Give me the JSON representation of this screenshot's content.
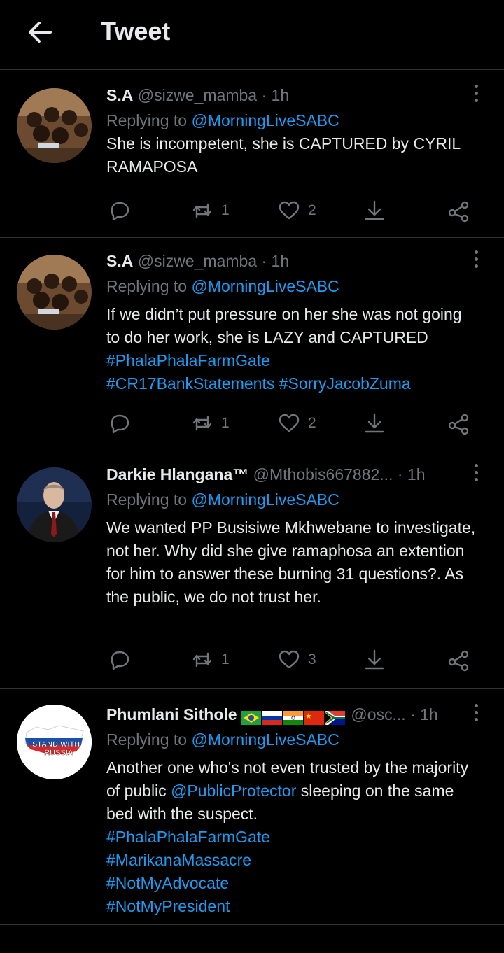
{
  "header": {
    "title": "Tweet",
    "back_icon": "arrow-left-icon"
  },
  "colors": {
    "background": "#000000",
    "text": "#e7e9ea",
    "muted": "#71767b",
    "link": "#1d9bf0",
    "divider": "#2f3336"
  },
  "tweets": [
    {
      "name": "S.A",
      "handle": "@sizwe_mamba",
      "dot": "·",
      "time": "1h",
      "replying_prefix": "Replying to ",
      "replying_to": "@MorningLiveSABC",
      "text_parts": [
        "She is incompetent, she is CAPTURED by CYRIL RAMAPOSA"
      ],
      "retweets": "1",
      "likes": "2"
    },
    {
      "name": "S.A",
      "handle": "@sizwe_mamba",
      "dot": "·",
      "time": "1h",
      "replying_prefix": "Replying to ",
      "replying_to": "@MorningLiveSABC",
      "text_parts": [
        "If we didn’t put pressure on her she was not going to do her work, she is LAZY and CAPTURED ",
        "#PhalaPhalaFarmGate",
        "#CR17BankStatements",
        "#SorryJacobZuma"
      ],
      "retweets": "1",
      "likes": "2"
    },
    {
      "name": "Darkie Hlangana™",
      "handle": "@Mthobis667882...",
      "dot": "·",
      "time": "1h",
      "replying_prefix": "Replying to ",
      "replying_to": "@MorningLiveSABC",
      "text_parts": [
        "We wanted PP Busisiwe Mkhwebane to investigate, not her. Why did she give ramaphosa an extention for him to answer these burning 31 questions?. As the public, we do not trust her."
      ],
      "retweets": "1",
      "likes": "3"
    },
    {
      "name": "Phumlani Sithole",
      "handle": "@osc...",
      "dot": "·",
      "time": "1h",
      "replying_prefix": "Replying to ",
      "replying_to": "@MorningLiveSABC",
      "text_parts": [
        "Another one who's not even trusted by the majority of public ",
        "@PublicProtector",
        " sleeping on the same bed with the suspect.",
        "#PhalaPhalaFarmGate",
        "#MarikanaMassacre",
        "#NotMyAdvocate",
        "#NotMyPresident"
      ],
      "avatar_text": [
        "I STAND WITH",
        "RUSSIA"
      ]
    }
  ]
}
